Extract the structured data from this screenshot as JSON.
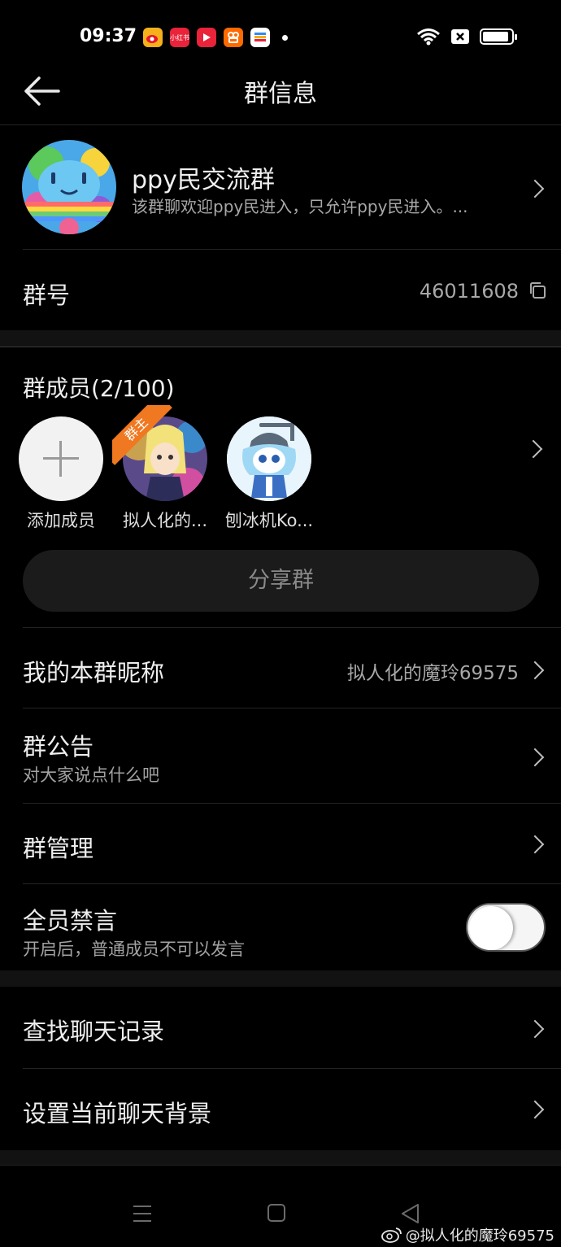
{
  "status_bar": {
    "time": "09:37",
    "app_icons": [
      {
        "name": "weibo-icon",
        "color": "#f5b01b"
      },
      {
        "name": "xiaohongshu-icon",
        "color": "#e8233a",
        "text": "小红书"
      },
      {
        "name": "video-app-icon",
        "color": "#e8233a"
      },
      {
        "name": "kuaishou-icon",
        "color": "#ff6a00"
      },
      {
        "name": "wallet-icon",
        "color": "#ffffff"
      }
    ],
    "battery_level": 0.9
  },
  "header": {
    "title": "群信息"
  },
  "group": {
    "name": "ppy民交流群",
    "description": "该群聊欢迎ppy民进入，只允许ppy民进入。..."
  },
  "group_id": {
    "label": "群号",
    "value": "46011608"
  },
  "members": {
    "title": "群成员(2/100)",
    "add_label": "添加成员",
    "owner_badge": "群主",
    "list": [
      {
        "name": "拟人化的..."
      },
      {
        "name": "刨冰机Ko..."
      }
    ]
  },
  "share_button": "分享群",
  "settings": {
    "nickname": {
      "label": "我的本群昵称",
      "value": "拟人化的魔玲69575"
    },
    "announcement": {
      "label": "群公告",
      "sub": "对大家说点什么吧"
    },
    "management": {
      "label": "群管理"
    },
    "mute_all": {
      "label": "全员禁言",
      "sub": "开启后，普通成员不可以发言",
      "enabled": false
    },
    "search_history": {
      "label": "查找聊天记录"
    },
    "chat_background": {
      "label": "设置当前聊天背景"
    }
  },
  "watermark": "@拟人化的魔玲69575"
}
